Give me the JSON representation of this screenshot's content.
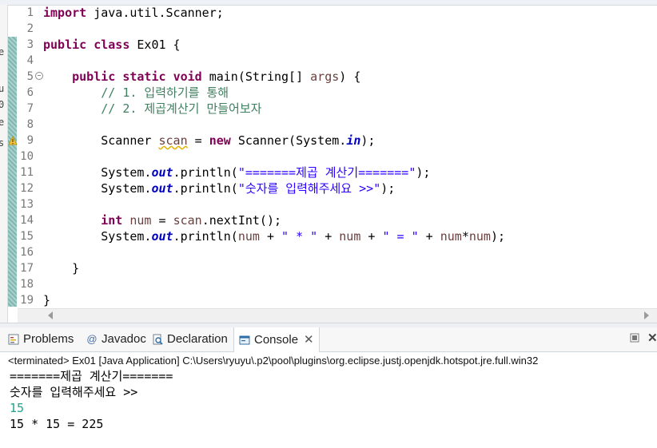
{
  "editor": {
    "lines": [
      {
        "n": "1",
        "segs": [
          {
            "t": "import",
            "c": "kw"
          },
          {
            "t": " java.util.Scanner;",
            "c": ""
          }
        ]
      },
      {
        "n": "2",
        "segs": []
      },
      {
        "n": "3",
        "segs": [
          {
            "t": "public",
            "c": "kw"
          },
          {
            "t": " ",
            "c": ""
          },
          {
            "t": "class",
            "c": "kw"
          },
          {
            "t": " Ex01 {",
            "c": ""
          }
        ]
      },
      {
        "n": "4",
        "segs": []
      },
      {
        "n": "5",
        "fold": true,
        "segs": [
          {
            "t": "    ",
            "c": ""
          },
          {
            "t": "public",
            "c": "kw"
          },
          {
            "t": " ",
            "c": ""
          },
          {
            "t": "static",
            "c": "kw"
          },
          {
            "t": " ",
            "c": ""
          },
          {
            "t": "void",
            "c": "kw"
          },
          {
            "t": " main(String[] ",
            "c": ""
          },
          {
            "t": "args",
            "c": "var"
          },
          {
            "t": ") {",
            "c": ""
          }
        ]
      },
      {
        "n": "6",
        "segs": [
          {
            "t": "        // 1. 입력하기를 통해",
            "c": "cm"
          }
        ]
      },
      {
        "n": "7",
        "segs": [
          {
            "t": "        // 2. 제곱계산기 만들어보자",
            "c": "cm"
          }
        ]
      },
      {
        "n": "8",
        "segs": []
      },
      {
        "n": "9",
        "segs": [
          {
            "t": "        Scanner ",
            "c": ""
          },
          {
            "t": "scan",
            "c": "var sq"
          },
          {
            "t": " = ",
            "c": ""
          },
          {
            "t": "new",
            "c": "kw"
          },
          {
            "t": " Scanner(System.",
            "c": ""
          },
          {
            "t": "in",
            "c": "fld"
          },
          {
            "t": ");",
            "c": ""
          }
        ]
      },
      {
        "n": "10",
        "segs": []
      },
      {
        "n": "11",
        "segs": [
          {
            "t": "        System.",
            "c": ""
          },
          {
            "t": "out",
            "c": "fld"
          },
          {
            "t": ".println(",
            "c": ""
          },
          {
            "t": "\"=======제곱 계산기=======\"",
            "c": "st"
          },
          {
            "t": ");",
            "c": ""
          }
        ]
      },
      {
        "n": "12",
        "segs": [
          {
            "t": "        System.",
            "c": ""
          },
          {
            "t": "out",
            "c": "fld"
          },
          {
            "t": ".println(",
            "c": ""
          },
          {
            "t": "\"숫자를 입력해주세요 >>\"",
            "c": "st"
          },
          {
            "t": ");",
            "c": ""
          }
        ]
      },
      {
        "n": "13",
        "segs": []
      },
      {
        "n": "14",
        "segs": [
          {
            "t": "        ",
            "c": ""
          },
          {
            "t": "int",
            "c": "kw"
          },
          {
            "t": " ",
            "c": ""
          },
          {
            "t": "num",
            "c": "var"
          },
          {
            "t": " = ",
            "c": ""
          },
          {
            "t": "scan",
            "c": "var"
          },
          {
            "t": ".nextInt();",
            "c": ""
          }
        ]
      },
      {
        "n": "15",
        "segs": [
          {
            "t": "        System.",
            "c": ""
          },
          {
            "t": "out",
            "c": "fld"
          },
          {
            "t": ".println(",
            "c": ""
          },
          {
            "t": "num",
            "c": "var"
          },
          {
            "t": " + ",
            "c": ""
          },
          {
            "t": "\" * \"",
            "c": "st"
          },
          {
            "t": " + ",
            "c": ""
          },
          {
            "t": "num",
            "c": "var"
          },
          {
            "t": " + ",
            "c": ""
          },
          {
            "t": "\" = \"",
            "c": "st"
          },
          {
            "t": " + ",
            "c": ""
          },
          {
            "t": "num",
            "c": "var"
          },
          {
            "t": "*",
            "c": ""
          },
          {
            "t": "num",
            "c": "var"
          },
          {
            "t": ");",
            "c": ""
          }
        ]
      },
      {
        "n": "16",
        "segs": []
      },
      {
        "n": "17",
        "segs": [
          {
            "t": "    }",
            "c": ""
          }
        ]
      },
      {
        "n": "18",
        "segs": []
      },
      {
        "n": "19",
        "segs": [
          {
            "t": "}",
            "c": ""
          }
        ]
      }
    ],
    "left_gutter_chars": [
      "e",
      "u",
      "0",
      "e",
      "s"
    ]
  },
  "tabs": [
    {
      "name": "tab-problems",
      "label": "Problems",
      "icon": "problems-icon"
    },
    {
      "name": "tab-javadoc",
      "label": "Javadoc",
      "icon": "at-icon"
    },
    {
      "name": "tab-declaration",
      "label": "Declaration",
      "icon": "declaration-icon"
    },
    {
      "name": "tab-console",
      "label": "Console",
      "icon": "console-icon",
      "active": true
    }
  ],
  "console": {
    "terminated": "<terminated> Ex01 [Java Application] C:\\Users\\ryuyu\\.p2\\pool\\plugins\\org.eclipse.justj.openjdk.hotspot.jre.full.win32",
    "output": [
      {
        "t": "=======제곱 계산기=======",
        "input": false
      },
      {
        "t": "숫자를 입력해주세요 >>",
        "input": false
      },
      {
        "t": "15",
        "input": true
      },
      {
        "t": "15 * 15 = 225",
        "input": false
      }
    ]
  },
  "colors": {
    "keyword": "#7f0055",
    "comment": "#3f7f5f",
    "string": "#2a00ff",
    "field": "#0000c0",
    "console_input": "#1fa38c"
  }
}
